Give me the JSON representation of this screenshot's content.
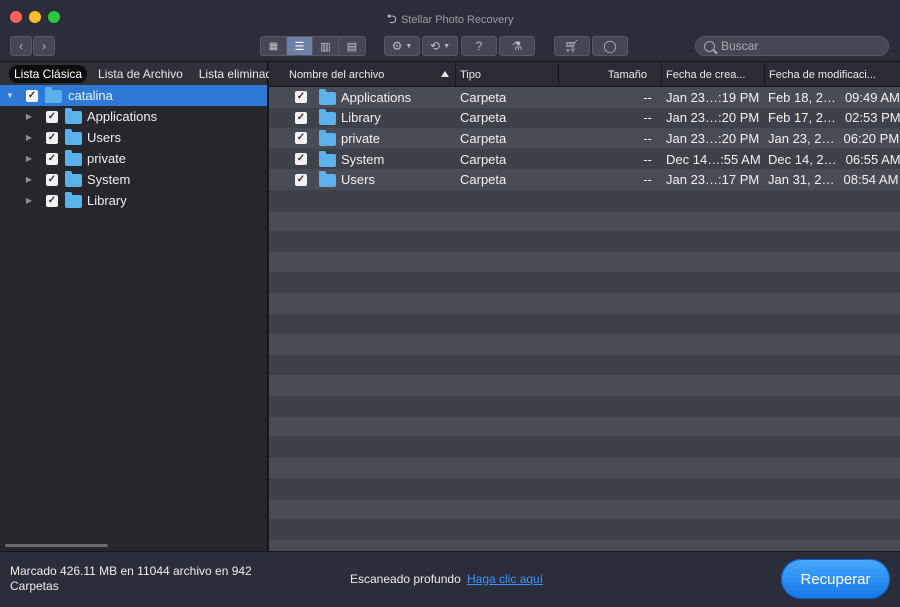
{
  "window": {
    "title": "Stellar Photo Recovery"
  },
  "toolbar": {
    "back_icon": "chevron-left-icon",
    "forward_icon": "chevron-right-icon",
    "views": [
      "grid-view-icon",
      "list-view-icon",
      "column-view-icon",
      "coverflow-view-icon"
    ],
    "active_view": 1,
    "search_placeholder": "Buscar"
  },
  "sidebar": {
    "tabs": [
      {
        "label": "Lista Clásica",
        "active": true
      },
      {
        "label": "Lista de Archivo",
        "active": false
      },
      {
        "label": "Lista eliminada",
        "active": false
      }
    ],
    "root": {
      "label": "catalina",
      "checked": true
    },
    "items": [
      {
        "label": "Applications",
        "checked": true
      },
      {
        "label": "Users",
        "checked": true
      },
      {
        "label": "private",
        "checked": true
      },
      {
        "label": "System",
        "checked": true
      },
      {
        "label": "Library",
        "checked": true
      }
    ]
  },
  "table": {
    "columns": [
      "Nombre del archivo",
      "Tipo",
      "Tamaño",
      "Fecha de crea...",
      "Fecha de modificaci..."
    ],
    "rows": [
      {
        "name": "Applications",
        "type": "Carpeta",
        "size": "--",
        "created": "Jan 23…:19 PM",
        "modified_date": "Feb 18, 2…",
        "modified_time": "09:49 AM"
      },
      {
        "name": "Library",
        "type": "Carpeta",
        "size": "--",
        "created": "Jan 23…:20 PM",
        "modified_date": "Feb 17, 2…",
        "modified_time": "02:53 PM"
      },
      {
        "name": "private",
        "type": "Carpeta",
        "size": "--",
        "created": "Jan 23…:20 PM",
        "modified_date": "Jan 23, 2…",
        "modified_time": "06:20 PM"
      },
      {
        "name": "System",
        "type": "Carpeta",
        "size": "--",
        "created": "Dec 14…:55 AM",
        "modified_date": "Dec 14, 2…",
        "modified_time": "06:55 AM"
      },
      {
        "name": "Users",
        "type": "Carpeta",
        "size": "--",
        "created": "Jan 23…:17 PM",
        "modified_date": "Jan 31, 2…",
        "modified_time": "08:54 AM"
      }
    ]
  },
  "footer": {
    "status": "Marcado 426.11 MB en 11044 archivo en 942 Carpetas",
    "scan_label": "Escaneado profundo",
    "scan_link": "Haga clic aquí",
    "recover_label": "Recuperar"
  },
  "colors": {
    "accent": "#2f79d6",
    "recover_button": "#1f86f0",
    "link": "#3d96ff"
  }
}
